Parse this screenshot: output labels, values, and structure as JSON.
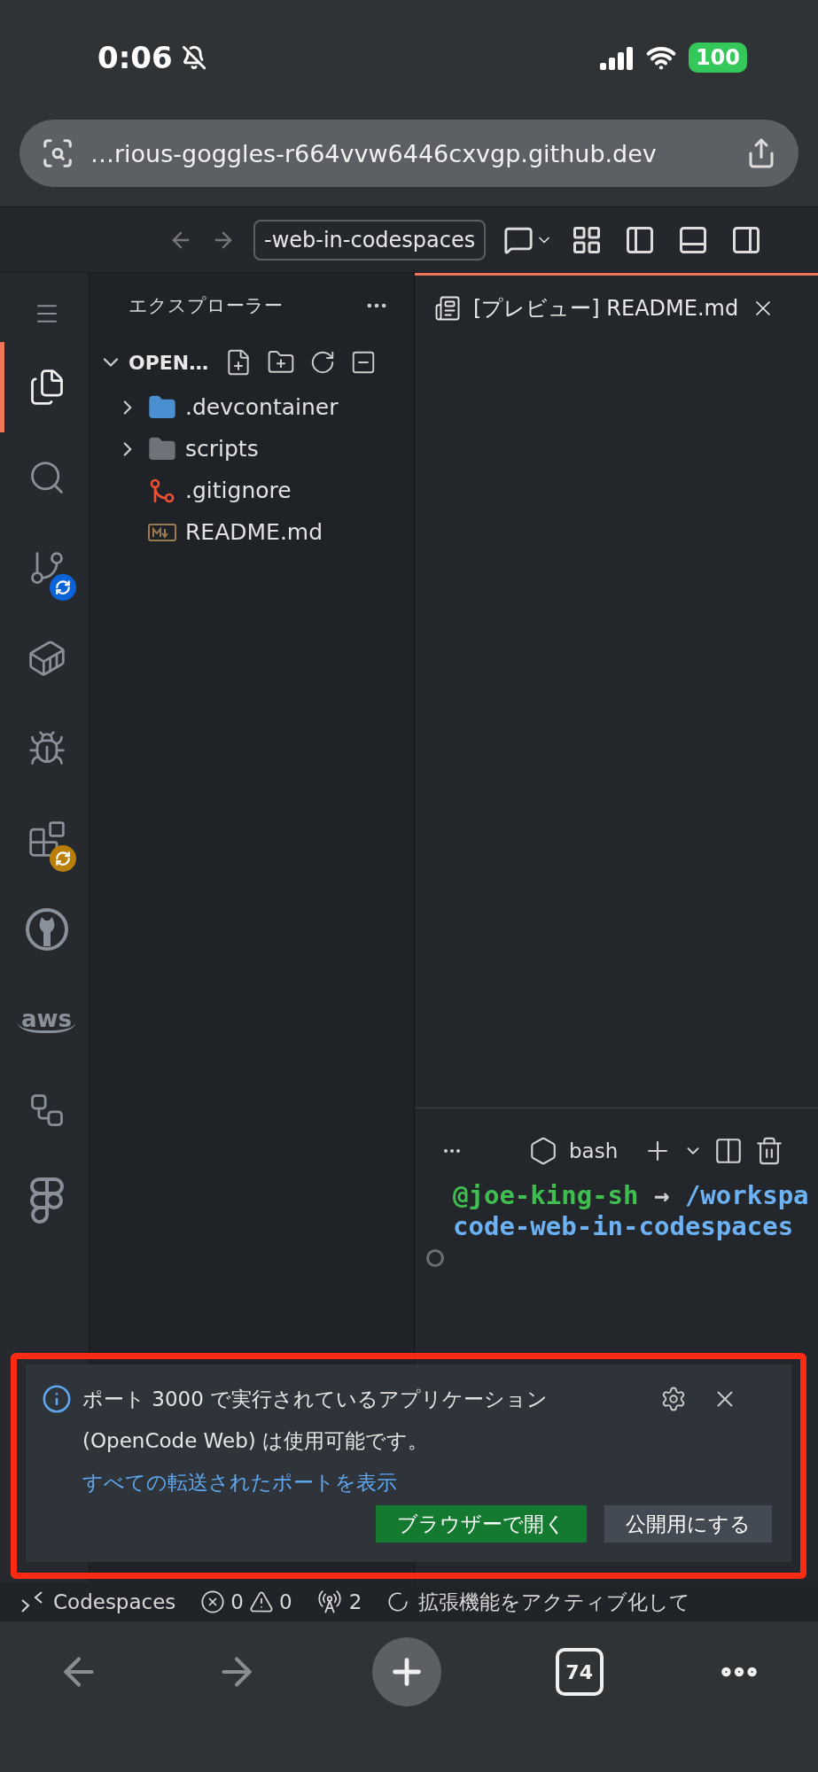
{
  "phone_status": {
    "time": "0:06",
    "muted": true,
    "battery": "100"
  },
  "address_bar": {
    "url": "…rious-goggles-r664vvw6446cxvgp.github.dev"
  },
  "title_bar": {
    "command_center": "-web-in-codespaces"
  },
  "activity_bar": [
    {
      "kind": "explorer",
      "selected": true
    },
    {
      "kind": "search",
      "selected": false
    },
    {
      "kind": "source-control",
      "selected": false,
      "badge": {
        "color": "#0b63d9"
      }
    },
    {
      "kind": "remote",
      "selected": false
    },
    {
      "kind": "run-debug",
      "selected": false
    },
    {
      "kind": "extensions",
      "selected": false,
      "badge": {
        "color": "#b97f0a"
      }
    },
    {
      "kind": "github",
      "selected": false
    },
    {
      "kind": "aws",
      "selected": false,
      "label": "aws"
    },
    {
      "kind": "workflow",
      "selected": false
    },
    {
      "kind": "figma",
      "selected": false
    }
  ],
  "explorer": {
    "title": "エクスプローラー",
    "section": {
      "label": "OPEN…",
      "expanded": true
    },
    "items": [
      {
        "name": ".devcontainer",
        "kind": "remote-folder",
        "expanded": false
      },
      {
        "name": "scripts",
        "kind": "code-folder",
        "expanded": false
      },
      {
        "name": ".gitignore",
        "kind": "git-file"
      },
      {
        "name": "README.md",
        "kind": "markdown-file"
      }
    ]
  },
  "editor": {
    "tabs": [
      {
        "label": "[プレビュー] README.md",
        "selected": true
      }
    ]
  },
  "terminal": {
    "shell": "bash",
    "lines": [
      [
        {
          "text": "@joe-king-sh",
          "kind": "user"
        },
        {
          "text": " → ",
          "kind": "arrow"
        },
        {
          "text": "/workspa",
          "kind": "path"
        }
      ],
      [
        {
          "text": "code-web-in-codespaces",
          "kind": "path"
        }
      ]
    ]
  },
  "notification": {
    "message": "ポート 3000 で実行されているアプリケーション (OpenCode Web) は使用可能です。",
    "link": "すべての転送されたポートを表示",
    "buttons": [
      {
        "label": "ブラウザーで開く",
        "kind": "primary"
      },
      {
        "label": "公開用にする",
        "kind": "secondary"
      }
    ]
  },
  "status_bar": {
    "remote": "Codespaces",
    "errors": "0",
    "warnings": "0",
    "ports": "2",
    "activity": "拡張機能をアクティブ化して"
  },
  "browser_toolbar": {
    "tab_count": "74"
  }
}
